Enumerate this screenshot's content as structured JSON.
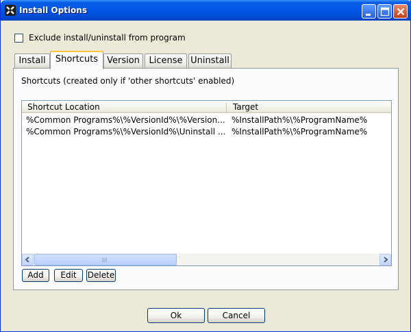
{
  "window": {
    "title": "Install Options"
  },
  "options": {
    "exclude_label": "Exclude install/uninstall from program",
    "exclude_checked": false
  },
  "tabs": [
    {
      "label": "Install"
    },
    {
      "label": "Shortcuts"
    },
    {
      "label": "Version"
    },
    {
      "label": "License"
    },
    {
      "label": "Uninstall"
    }
  ],
  "active_tab": "Shortcuts",
  "panel": {
    "caption": "Shortcuts (created only if 'other shortcuts' enabled)",
    "columns": [
      "Shortcut Location",
      "Target"
    ],
    "rows": [
      [
        "%Common Programs%\\%VersionId%\\%Version...",
        "%InstallPath%\\%ProgramName%"
      ],
      [
        "%Common Programs%\\%VersionId%\\Uninstall ...",
        "%InstallPath%\\%ProgramName%"
      ]
    ]
  },
  "list_buttons": {
    "add": "Add",
    "edit": "Edit",
    "delete": "Delete"
  },
  "footer": {
    "ok": "Ok",
    "cancel": "Cancel"
  },
  "colors": {
    "titlebar": "#0055E5",
    "face": "#ECE9D8",
    "tab_highlight": "#FFC83C"
  }
}
